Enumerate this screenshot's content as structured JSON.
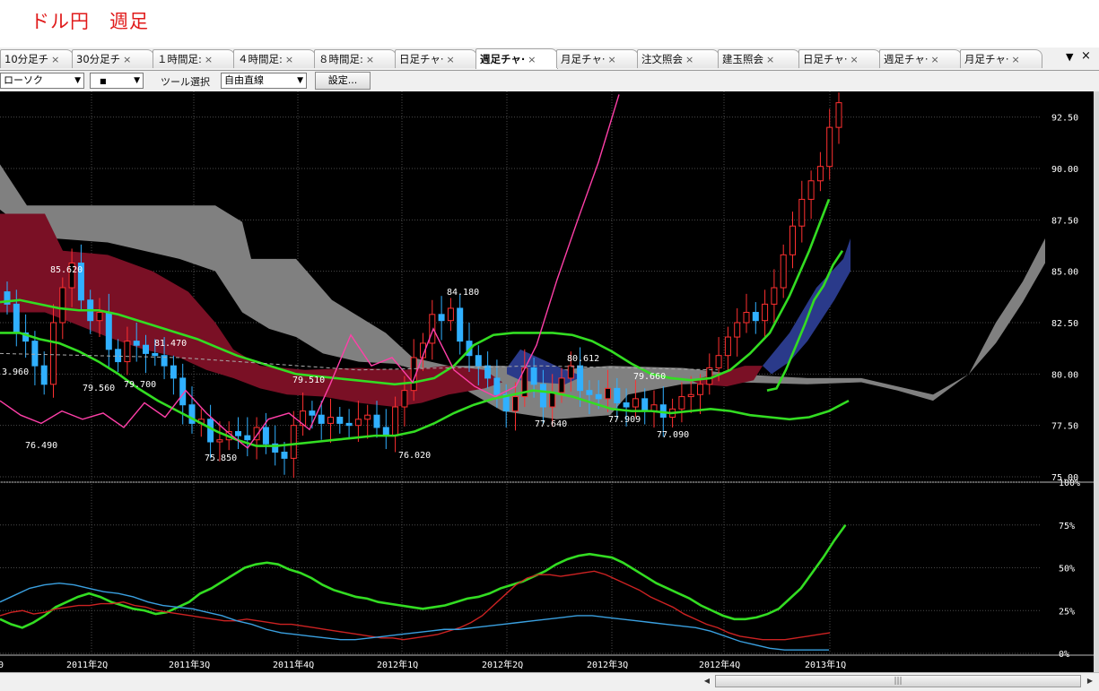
{
  "page": {
    "title": "ドル円　週足"
  },
  "tabs": [
    {
      "label": "10分足チ",
      "active": false
    },
    {
      "label": "30分足チ",
      "active": false
    },
    {
      "label": "１時間足:",
      "active": false
    },
    {
      "label": "４時間足:",
      "active": false
    },
    {
      "label": "８時間足:",
      "active": false
    },
    {
      "label": "日足チャ·",
      "active": false
    },
    {
      "label": "週足チャ·",
      "active": true
    },
    {
      "label": "月足チャ·",
      "active": false
    },
    {
      "label": "注文照会",
      "active": false
    },
    {
      "label": "建玉照会",
      "active": false
    },
    {
      "label": "日足チャ·",
      "active": false
    },
    {
      "label": "週足チャ·",
      "active": false
    },
    {
      "label": "月足チャ·",
      "active": false
    }
  ],
  "tab_close_glyph": "×",
  "tab_controls": {
    "menu": "▼",
    "close": "×"
  },
  "toolbar": {
    "chart_type_value": "ローソク",
    "style_value": "■",
    "tool_label": "ツール選択",
    "tool_value": "自由直線",
    "settings_label": "設定..."
  },
  "chart_data": {
    "type": "line",
    "main_panel": {
      "y_ticks": [
        "92.50",
        "90.00",
        "87.50",
        "85.00",
        "82.50",
        "80.00",
        "77.50",
        "75.00"
      ],
      "ylim": [
        75.0,
        93.75
      ],
      "annotations": [
        "3.960",
        "85.620",
        "81.470",
        "79.560",
        "79.700",
        "76.490",
        "75.850",
        "79.510",
        "84.180",
        "76.020",
        "80.612",
        "77.640",
        "77.909",
        "79.660",
        "77.090"
      ]
    },
    "sub_panel": {
      "y_ticks": [
        "100%",
        "75%",
        "50%",
        "25%",
        "0%"
      ],
      "ylim": [
        0,
        100
      ]
    },
    "x_ticks": [
      "0",
      "2011年2Q",
      "2011年3Q",
      "2011年4Q",
      "2012年1Q",
      "2012年2Q",
      "2012年3Q",
      "2012年4Q",
      "2013年1Q"
    ],
    "series": [
      {
        "values": [
          83.5,
          83.6,
          83.4,
          83.2,
          83.1,
          83.1,
          82.9,
          82.6,
          82.3,
          82.0,
          81.7,
          81.3,
          80.9,
          80.6,
          80.3,
          80.0,
          79.9,
          79.8,
          79.7,
          79.6,
          79.5,
          79.6,
          79.8,
          80.4,
          81.4,
          81.9,
          82.0,
          82.0,
          82.0,
          81.9,
          81.6,
          81.1,
          80.5,
          80.0,
          79.8,
          79.7,
          79.8,
          80.2,
          81.0,
          82.0,
          83.8,
          86.0,
          88.5
        ]
      },
      {
        "values": [
          82.0,
          82.0,
          81.7,
          81.5,
          81.1,
          80.6,
          80.0,
          79.3,
          78.7,
          78.2,
          77.7,
          77.2,
          76.8,
          76.5,
          76.5,
          76.6,
          76.7,
          76.8,
          76.9,
          77.0,
          77.0,
          77.2,
          77.6,
          78.1,
          78.5,
          78.8,
          79.0,
          79.2,
          79.1,
          78.9,
          78.6,
          78.3,
          78.2,
          78.2,
          78.1,
          78.2,
          78.3,
          78.2,
          78.0,
          77.9,
          77.8,
          77.9,
          78.2,
          78.7
        ]
      },
      {
        "values": [
          78.7,
          78.0,
          77.6,
          78.2,
          77.8,
          78.1,
          77.4,
          78.6,
          77.9,
          79.2,
          78.1,
          77.2,
          76.4,
          77.8,
          78.1,
          77.3,
          79.5,
          81.9,
          80.4,
          80.8,
          79.6,
          82.2,
          80.2,
          79.4,
          78.9,
          79.4,
          81.4,
          84.6,
          87.5,
          90.3,
          93.6
        ]
      },
      {
        "values": [
          79.2,
          79.3,
          80.2,
          81.3,
          82.4,
          83.6,
          84.3,
          85.3,
          86.0
        ]
      }
    ],
    "oscillator_series": [
      {
        "values": [
          20,
          17,
          15,
          18,
          22,
          27,
          30,
          33,
          35,
          33,
          30,
          28,
          26,
          25,
          23,
          24,
          27,
          30,
          35,
          38,
          42,
          46,
          50,
          52,
          53,
          52,
          49,
          47,
          44,
          40,
          37,
          35,
          33,
          32,
          30,
          29,
          28,
          27,
          26,
          27,
          28,
          30,
          32,
          33,
          35,
          38,
          40,
          42,
          45,
          48,
          52,
          55,
          57,
          58,
          57,
          56,
          53,
          49,
          45,
          41,
          38,
          35,
          32,
          28,
          25,
          22,
          20,
          20,
          21,
          23,
          26,
          32,
          38,
          47,
          56,
          66,
          75
        ]
      },
      {
        "values": [
          22,
          24,
          25,
          23,
          24,
          26,
          27,
          28,
          28,
          29,
          29,
          30,
          28,
          27,
          25,
          24,
          23,
          22,
          21,
          20,
          19,
          19,
          20,
          19,
          18,
          17,
          17,
          16,
          15,
          14,
          13,
          12,
          11,
          10,
          9,
          9,
          8,
          9,
          10,
          11,
          13,
          15,
          18,
          22,
          28,
          34,
          40,
          44,
          46,
          46,
          45,
          46,
          47,
          48,
          46,
          43,
          40,
          37,
          33,
          30,
          27,
          23,
          20,
          17,
          15,
          12,
          10,
          9,
          8,
          8,
          8,
          9,
          10,
          11,
          12
        ]
      },
      {
        "values": [
          30,
          34,
          38,
          40,
          41,
          40,
          38,
          36,
          35,
          33,
          30,
          28,
          27,
          26,
          24,
          22,
          19,
          17,
          14,
          12,
          11,
          10,
          9,
          8,
          8,
          9,
          10,
          11,
          12,
          13,
          14,
          14,
          15,
          16,
          17,
          18,
          19,
          20,
          21,
          22,
          22,
          21,
          20,
          19,
          18,
          17,
          16,
          15,
          13,
          10,
          7,
          5,
          3,
          2,
          2,
          2,
          2
        ]
      }
    ]
  }
}
